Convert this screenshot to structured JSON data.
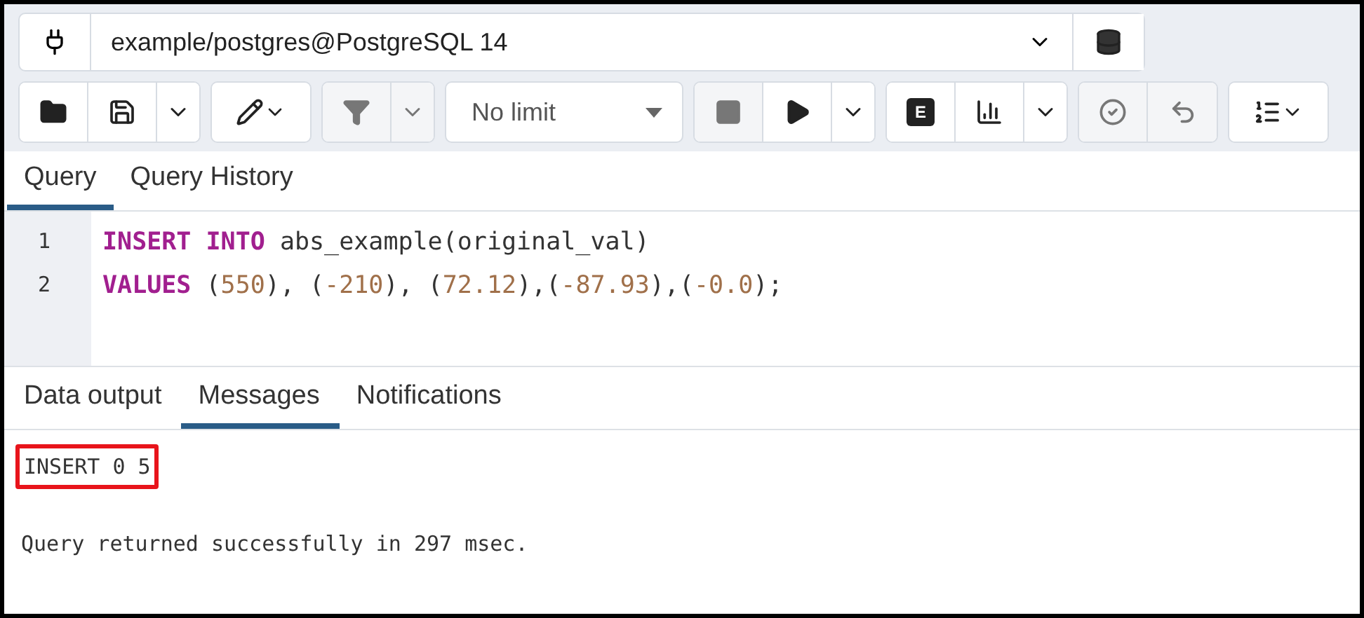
{
  "connection": {
    "value": "example/postgres@PostgreSQL 14"
  },
  "toolbar": [
    {
      "kind": "buttons",
      "items": [
        {
          "kind": "folder",
          "disabled": false
        },
        {
          "kind": "save",
          "disabled": false
        },
        {
          "kind": "caret",
          "disabled": false
        }
      ]
    },
    {
      "kind": "buttons",
      "items": [
        {
          "kind": "pencil",
          "disabled": false
        }
      ]
    },
    {
      "kind": "buttons",
      "items": [
        {
          "kind": "filter",
          "disabled": true
        },
        {
          "kind": "caret",
          "disabled": true
        }
      ]
    },
    {
      "kind": "select",
      "value": "No limit"
    },
    {
      "kind": "buttons",
      "items": [
        {
          "kind": "stop",
          "disabled": true
        },
        {
          "kind": "play",
          "disabled": false
        },
        {
          "kind": "caret",
          "disabled": false
        }
      ]
    },
    {
      "kind": "buttons",
      "items": [
        {
          "kind": "letter",
          "label": "E",
          "disabled": false
        },
        {
          "kind": "chart",
          "disabled": false
        },
        {
          "kind": "caret",
          "disabled": false
        }
      ]
    },
    {
      "kind": "buttons",
      "items": [
        {
          "kind": "commit",
          "disabled": true
        },
        {
          "kind": "rollback",
          "disabled": true
        }
      ]
    },
    {
      "kind": "buttons",
      "items": [
        {
          "kind": "list",
          "disabled": false
        }
      ]
    }
  ],
  "editor_tabs": [
    {
      "label": "Query",
      "selected": true
    },
    {
      "label": "Query History",
      "selected": false
    }
  ],
  "editor": {
    "lines": [
      {
        "number": "1",
        "tokens": [
          {
            "kind": "keyword",
            "text": "INSERT INTO"
          },
          {
            "kind": "plain",
            "text": " abs_example(original_val)"
          }
        ]
      },
      {
        "number": "2",
        "tokens": [
          {
            "kind": "keyword",
            "text": "VALUES"
          },
          {
            "kind": "plain",
            "text": " ("
          },
          {
            "kind": "number",
            "text": "550"
          },
          {
            "kind": "plain",
            "text": "), ("
          },
          {
            "kind": "number",
            "text": "-210"
          },
          {
            "kind": "plain",
            "text": "), ("
          },
          {
            "kind": "number",
            "text": "72.12"
          },
          {
            "kind": "plain",
            "text": "),("
          },
          {
            "kind": "number",
            "text": "-87.93"
          },
          {
            "kind": "plain",
            "text": "),("
          },
          {
            "kind": "number",
            "text": "-0.0"
          },
          {
            "kind": "plain",
            "text": ");"
          }
        ]
      }
    ]
  },
  "result_tabs": [
    {
      "label": "Data output",
      "selected": false
    },
    {
      "label": "Messages",
      "selected": true
    },
    {
      "label": "Notifications",
      "selected": false
    }
  ],
  "messages": [
    {
      "text": "INSERT 0 5",
      "highlighted": true
    },
    {
      "text": "Query returned successfully in 297 msec.",
      "highlighted": false
    }
  ]
}
